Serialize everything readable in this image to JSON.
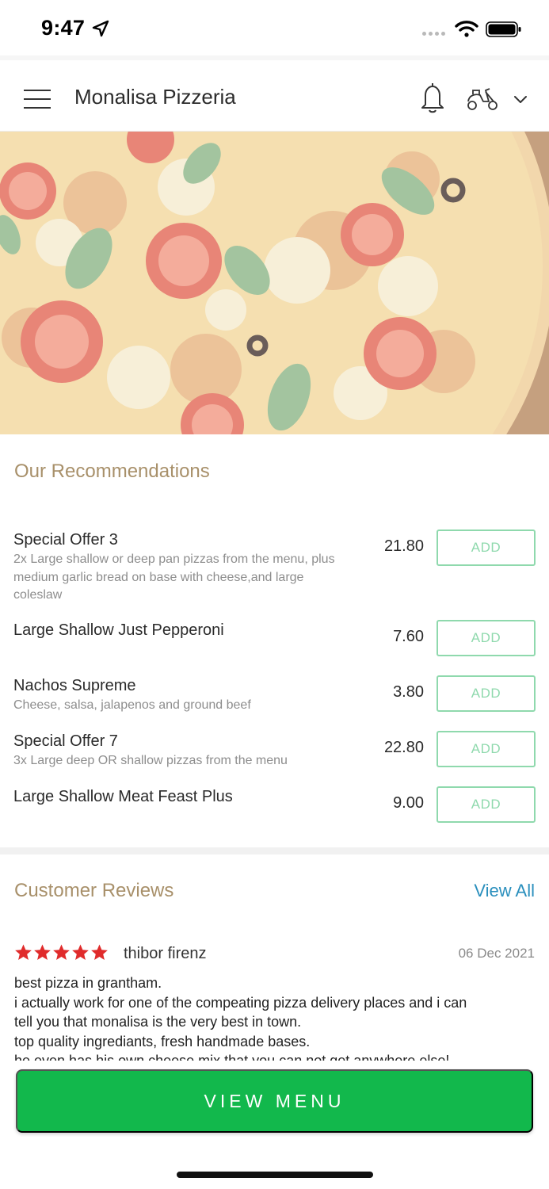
{
  "status_bar": {
    "time": "9:47"
  },
  "header": {
    "title": "Monalisa Pizzeria"
  },
  "recommendations": {
    "title": "Our Recommendations",
    "add_label": "ADD",
    "items": [
      {
        "name": "Special Offer 3",
        "desc_lines": [
          "2x Large shallow or deep pan pizzas from the menu, plus",
          "medium garlic bread on base with cheese,and large",
          "coleslaw"
        ],
        "price": "21.80"
      },
      {
        "name": "Large Shallow Just Pepperoni",
        "desc_lines": [],
        "price": "7.60"
      },
      {
        "name": "Nachos Supreme",
        "desc_lines": [
          "Cheese, salsa, jalapenos and ground beef"
        ],
        "price": "3.80"
      },
      {
        "name": "Special Offer 7",
        "desc_lines": [
          "3x Large deep OR shallow pizzas from the menu"
        ],
        "price": "22.80"
      },
      {
        "name": "Large Shallow Meat Feast Plus",
        "desc_lines": [],
        "price": "9.00"
      }
    ]
  },
  "reviews": {
    "title": "Customer Reviews",
    "view_all": "View All",
    "review": {
      "rating": 5,
      "reviewer": "thibor firenz",
      "date": "06 Dec 2021",
      "lines": [
        "best pizza in grantham.",
        "i actually work for one of the compeating pizza delivery places and i can",
        "tell you that monalisa is the very best in town.",
        "top quality ingrediants, fresh handmade bases.",
        "he even has his own cheese mix that you can not get anywhere else!"
      ]
    }
  },
  "footer": {
    "view_menu_label": "VIEW MENU"
  },
  "colors": {
    "accent_green": "#12b84c",
    "section_title": "#a8906a",
    "link_blue": "#2a8fbd",
    "star_red": "#e02b2b"
  },
  "icons": {
    "menu": "hamburger-icon",
    "notifications": "bell-icon",
    "delivery": "scooter-icon",
    "dropdown": "chevron-down-icon",
    "rating": "star-icon"
  }
}
